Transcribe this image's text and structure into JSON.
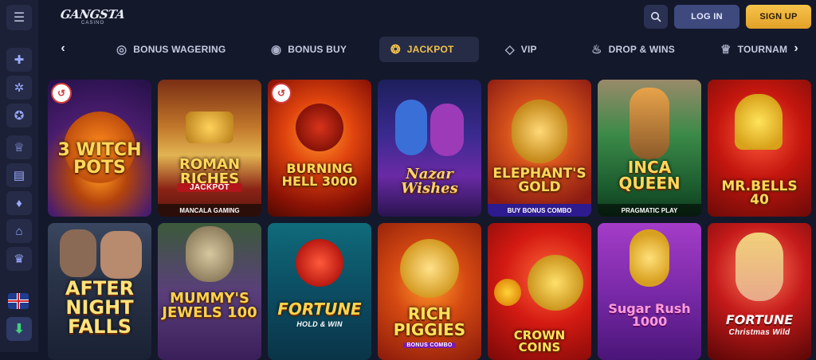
{
  "brand": {
    "logo_text": "GANGSTA",
    "logo_sub": "CASINO"
  },
  "header": {
    "login_label": "LOG IN",
    "signup_label": "SIGN UP",
    "search_icon": "search-icon",
    "menu_icon": "hamburger-icon"
  },
  "sidebar": {
    "items": [
      {
        "icon": "gift-icon",
        "glyph": "🎁"
      },
      {
        "icon": "wheel-icon",
        "glyph": "✲"
      },
      {
        "icon": "award-icon",
        "glyph": "✪"
      },
      {
        "icon": "trophy-icon",
        "glyph": "🏆"
      },
      {
        "icon": "ticket-icon",
        "glyph": "▤"
      },
      {
        "icon": "diamond-icon",
        "glyph": "♦"
      },
      {
        "icon": "basket-icon",
        "glyph": "⌂"
      },
      {
        "icon": "crown-icon",
        "glyph": "♛"
      }
    ],
    "language": "UK flag",
    "download_icon": "download-icon"
  },
  "categories": [
    {
      "label": "BONUS WAGERING",
      "icon": "coins-icon",
      "glyph": "◎",
      "active": false
    },
    {
      "label": "BONUS BUY",
      "icon": "bonus-buy-icon",
      "glyph": "◉",
      "active": false
    },
    {
      "label": "JACKPOT",
      "icon": "jackpot-icon",
      "glyph": "❂",
      "active": true
    },
    {
      "label": "VIP",
      "icon": "diamond-icon",
      "glyph": "◇",
      "active": false
    },
    {
      "label": "DROP & WINS",
      "icon": "drop-wins-icon",
      "glyph": "♨",
      "active": false
    },
    {
      "label": "TOURNAM",
      "icon": "trophy-icon",
      "glyph": "♕",
      "active": false
    }
  ],
  "games": [
    {
      "title": "3 WITCH POTS",
      "sub": "",
      "provider_badge": true
    },
    {
      "title": "ROMAN RICHES",
      "sub": "JACKPOT",
      "band": "MANCALA GAMING",
      "provider_badge": false
    },
    {
      "title": "BURNING HELL 3000",
      "sub": "",
      "provider_badge": true
    },
    {
      "title": "Nazar Wishes",
      "sub": "",
      "provider_badge": false
    },
    {
      "title": "ELEPHANT'S GOLD",
      "sub": "",
      "band": "BUY BONUS COMBO",
      "provider_badge": false
    },
    {
      "title": "INCA QUEEN",
      "sub": "",
      "band": "PRAGMATIC PLAY",
      "provider_badge": false
    },
    {
      "title": "MR.BELLS 40",
      "sub": "",
      "provider_badge": false
    },
    {
      "title": "AFTER NIGHT FALLS",
      "sub": "",
      "provider_badge": false
    },
    {
      "title": "MUMMY'S JEWELS 100",
      "sub": "",
      "provider_badge": false
    },
    {
      "title": "FORTUNE",
      "sub": "HOLD & WIN",
      "provider_badge": false
    },
    {
      "title": "RICH PIGGIES",
      "sub": "BONUS COMBO",
      "provider_badge": false
    },
    {
      "title": "CROWN COINS",
      "sub": "",
      "provider_badge": false
    },
    {
      "title": "Sugar Rush 1000",
      "sub": "",
      "provider_badge": false
    },
    {
      "title": "FORTUNE",
      "sub": "Christmas Wild",
      "provider_badge": false
    }
  ],
  "colors": {
    "accent": "#f2c04d",
    "background": "#14182b",
    "login": "#3e4a7d",
    "signup": "#f6c34a"
  }
}
